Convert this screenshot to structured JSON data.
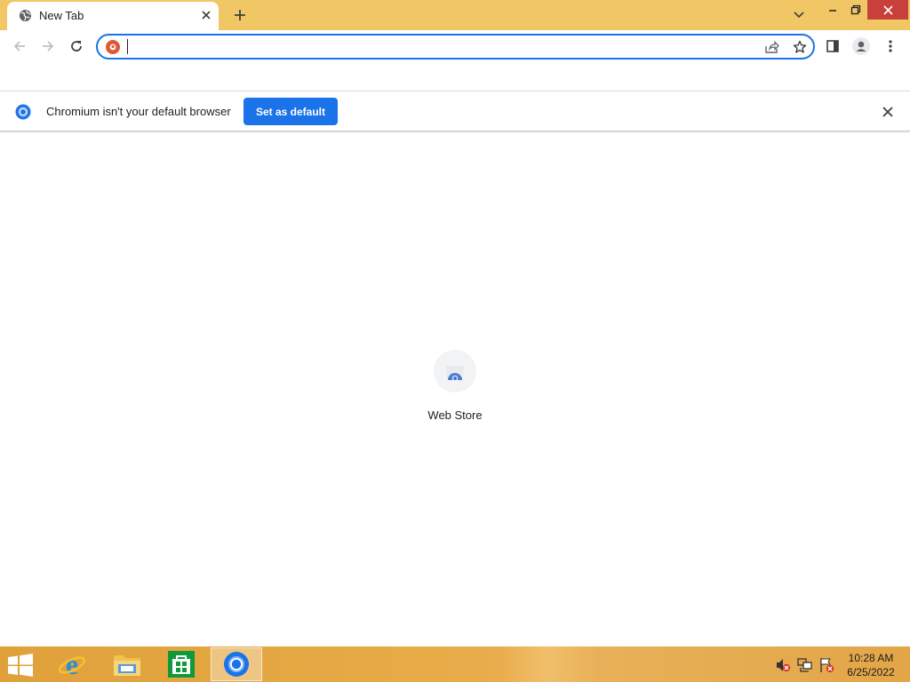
{
  "browser": {
    "tab": {
      "title": "New Tab",
      "favicon": "globe-icon"
    },
    "window_controls": [
      "tab-search",
      "minimize",
      "restore",
      "close"
    ],
    "colors": {
      "frame": "#f1c766",
      "accent": "#1a73e8",
      "close": "#c7403a"
    }
  },
  "toolbar": {
    "omnibox": {
      "value": "",
      "search_engine": "duckduckgo-icon"
    }
  },
  "infobar": {
    "message": "Chromium isn't your default browser",
    "button_label": "Set as default"
  },
  "ntp": {
    "shortcuts": [
      {
        "label": "Web Store",
        "icon": "web-store-icon"
      }
    ]
  },
  "taskbar": {
    "apps": [
      "internet-explorer",
      "file-explorer",
      "store",
      "chromium"
    ],
    "clock": {
      "time": "10:28 AM",
      "date": "6/25/2022"
    }
  }
}
